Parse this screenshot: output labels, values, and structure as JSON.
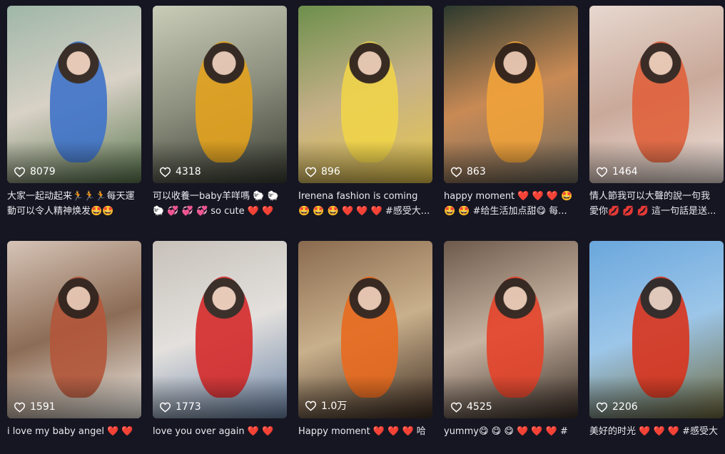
{
  "cards": [
    {
      "likes": "8079",
      "line1": "大家一起动起来🏃🏃🏃每天運",
      "line2": "動可以令人精神焕发🤩🤩",
      "colors": [
        "#9fb7a8",
        "#d8d1c6",
        "#5e7a52"
      ],
      "accent": "#3f73c9"
    },
    {
      "likes": "4318",
      "line1": "可以收養一baby羊咩嗎 🐑 🐑",
      "line2": "🐑 💞 💞 💞 so cute ❤️ ❤️",
      "colors": [
        "#c9cdb8",
        "#8c8f7d",
        "#3a3d33"
      ],
      "accent": "#e3a21d"
    },
    {
      "likes": "896",
      "line1": "Irenena fashion is coming",
      "line2": "🤩 🤩 🤩 ❤️ ❤️ ❤️ #感受大...",
      "colors": [
        "#6d8f4c",
        "#c5b088",
        "#e8c94b"
      ],
      "accent": "#f0d44a"
    },
    {
      "likes": "863",
      "line1": "happy moment ❤️ ❤️ ❤️ 🤩",
      "line2": "🤩 🤩 #给生活加点甜😋 每...",
      "colors": [
        "#2c3a2e",
        "#c98a55",
        "#6e6a5f"
      ],
      "accent": "#f0a23a"
    },
    {
      "likes": "1464",
      "line1": "情人節我可以大聲的說一句我",
      "line2": "愛你💋 💋 💋 這一句話是送...",
      "colors": [
        "#e7d8cf",
        "#c9a99a",
        "#f3e6e0"
      ],
      "accent": "#e0613b"
    },
    {
      "likes": "1591",
      "line1": "i love my baby angel ❤️ ❤️",
      "line2": "",
      "colors": [
        "#d6c4b7",
        "#8c6c55",
        "#f2eee8"
      ],
      "accent": "#b3563a"
    },
    {
      "likes": "1773",
      "line1": "love you over again ❤️ ❤️",
      "line2": "",
      "colors": [
        "#c7c1b9",
        "#e3e0dd",
        "#6d86a8"
      ],
      "accent": "#d62a2a"
    },
    {
      "likes": "1.0万",
      "line1": "Happy moment ❤️ ❤️ ❤️ 哈",
      "line2": "",
      "colors": [
        "#8a6a4e",
        "#c9b08c",
        "#3e2d22"
      ],
      "accent": "#e86a1e"
    },
    {
      "likes": "4525",
      "line1": "yummy😋 😋 😋 ❤️ ❤️ ❤️ #",
      "line2": "",
      "colors": [
        "#6d5a4b",
        "#c8b4a2",
        "#3b2f28"
      ],
      "accent": "#e5432a"
    },
    {
      "likes": "2206",
      "line1": "美好的时光 ❤️ ❤️ ❤️ #感受大",
      "line2": "",
      "colors": [
        "#6aa7dc",
        "#9cc6e9",
        "#6f6a3e"
      ],
      "accent": "#d9331c"
    }
  ]
}
